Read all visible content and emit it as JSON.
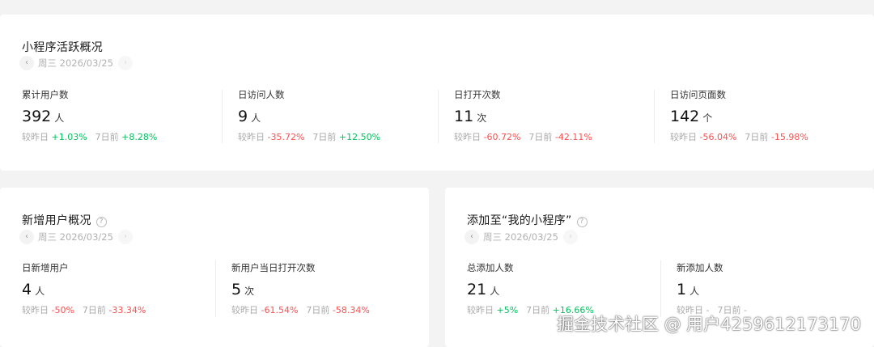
{
  "activity": {
    "title": "小程序活跃概况",
    "date": "周三 2026/03/25",
    "metrics": [
      {
        "label": "累计用户数",
        "value": "392",
        "unit": "人",
        "day_label": "较昨日",
        "day_change": "+1.03%",
        "week_label": "7日前",
        "week_change": "+8.28%"
      },
      {
        "label": "日访问人数",
        "value": "9",
        "unit": "人",
        "day_label": "较昨日",
        "day_change": "-35.72%",
        "week_label": "7日前",
        "week_change": "+12.50%"
      },
      {
        "label": "日打开次数",
        "value": "11",
        "unit": "次",
        "day_label": "较昨日",
        "day_change": "-60.72%",
        "week_label": "7日前",
        "week_change": "-42.11%"
      },
      {
        "label": "日访问页面数",
        "value": "142",
        "unit": "个",
        "day_label": "较昨日",
        "day_change": "-56.04%",
        "week_label": "7日前",
        "week_change": "-15.98%"
      }
    ]
  },
  "new_users": {
    "title": "新增用户概况",
    "help": "?",
    "date": "周三 2026/03/25",
    "metrics": [
      {
        "label": "日新增用户",
        "value": "4",
        "unit": "人",
        "day_label": "较昨日",
        "day_change": "-50%",
        "week_label": "7日前",
        "week_change": "-33.34%"
      },
      {
        "label": "新用户当日打开次数",
        "value": "5",
        "unit": "次",
        "day_label": "较昨日",
        "day_change": "-61.54%",
        "week_label": "7日前",
        "week_change": "-58.34%"
      }
    ]
  },
  "added": {
    "title": "添加至“我的小程序”",
    "help": "?",
    "date": "周三 2026/03/25",
    "metrics": [
      {
        "label": "总添加人数",
        "value": "21",
        "unit": "人",
        "day_label": "较昨日",
        "day_change": "+5%",
        "week_label": "7日前",
        "week_change": "+16.66%"
      },
      {
        "label": "新添加人数",
        "value": "1",
        "unit": "人",
        "day_label": "较昨日",
        "day_change": "-",
        "week_label": "7日前",
        "week_change": "-"
      }
    ]
  },
  "nav": {
    "prev_icon": "‹",
    "next_icon": "›"
  },
  "watermark": "掘金技术社区 @ 用户4259612173170",
  "colors": {
    "positive": "#07c160",
    "negative": "#fa5151",
    "neutral": "#aaaaaa"
  }
}
